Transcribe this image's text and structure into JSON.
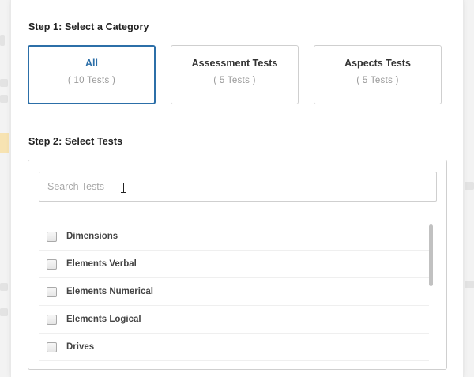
{
  "step1": {
    "title": "Step 1: Select a Category",
    "categories": [
      {
        "name": "All",
        "count": "( 10 Tests )",
        "selected": true
      },
      {
        "name": "Assessment Tests",
        "count": "( 5 Tests )",
        "selected": false
      },
      {
        "name": "Aspects Tests",
        "count": "( 5 Tests )",
        "selected": false
      }
    ]
  },
  "step2": {
    "title": "Step 2: Select Tests",
    "search": {
      "placeholder": "Search Tests",
      "value": ""
    },
    "tests": [
      {
        "label": "Dimensions",
        "checked": false
      },
      {
        "label": "Elements Verbal",
        "checked": false
      },
      {
        "label": "Elements Numerical",
        "checked": false
      },
      {
        "label": "Elements Logical",
        "checked": false
      },
      {
        "label": "Drives",
        "checked": false
      }
    ]
  },
  "colors": {
    "accent": "#2c6fa8",
    "border": "#cfcfcf",
    "muted_text": "#9a9a9a"
  }
}
